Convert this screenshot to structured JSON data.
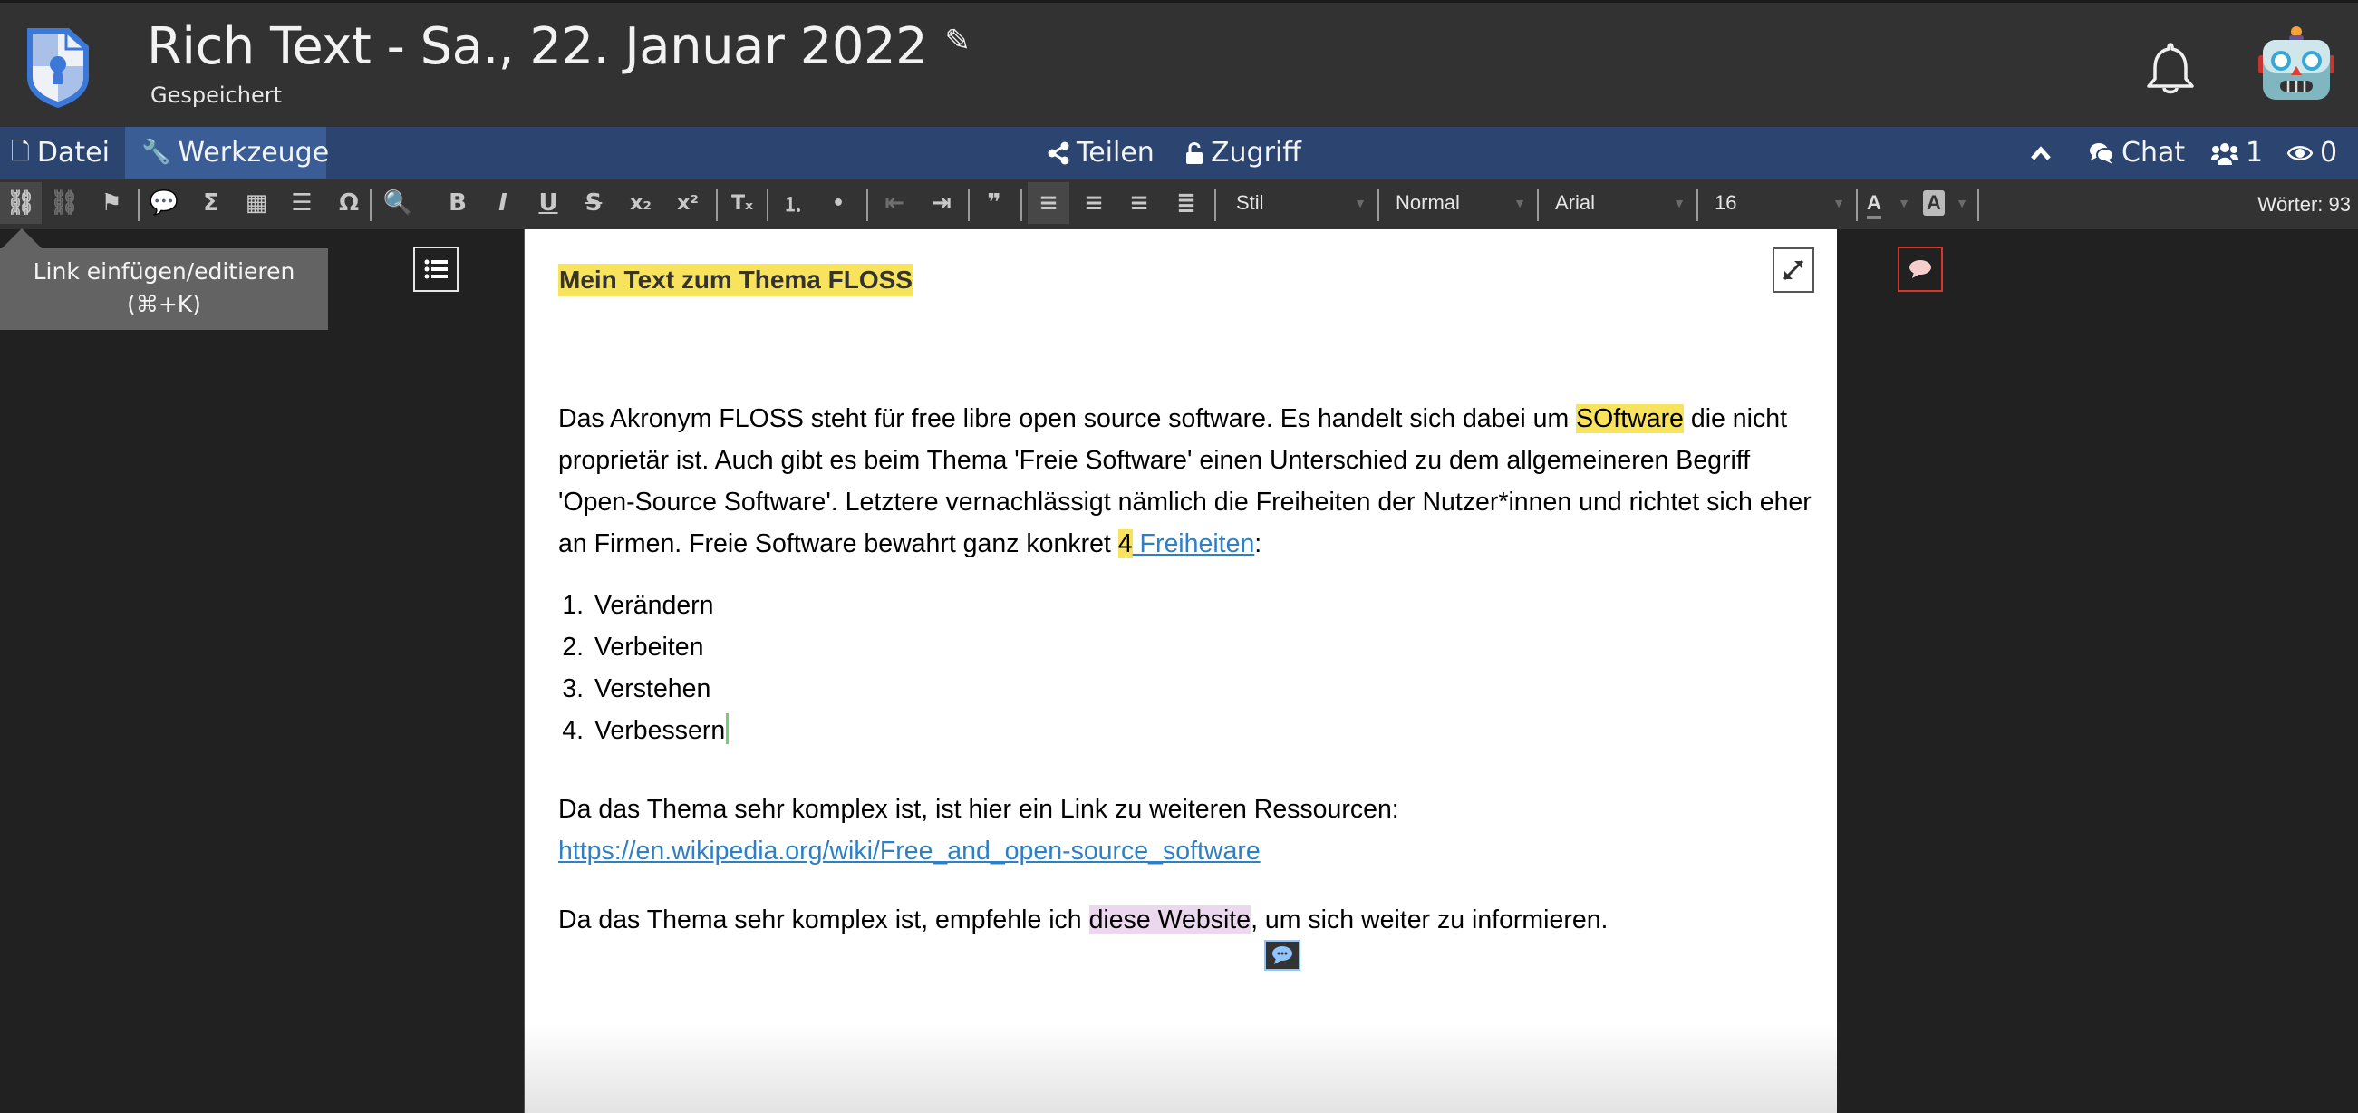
{
  "header": {
    "title": "Rich Text - Sa., 22. Januar 2022",
    "status": "Gespeichert",
    "edit_icon": "pencil-icon",
    "notifications_icon": "bell-icon",
    "avatar_icon": "robot-face-icon",
    "logo_icon": "shield-keyhole-logo"
  },
  "menubar": {
    "file": {
      "label": "Datei",
      "icon": "file-icon"
    },
    "tools": {
      "label": "Werkzeuge",
      "icon": "wrench-icon"
    },
    "share": {
      "label": "Teilen",
      "icon": "share-icon"
    },
    "access": {
      "label": "Zugriff",
      "icon": "unlock-icon"
    },
    "collapse_icon": "chevron-up-icon",
    "chat": {
      "label": "Chat",
      "icon": "comments-icon"
    },
    "users": {
      "count": "1",
      "icon": "users-icon"
    },
    "viewers": {
      "count": "0",
      "icon": "eye-icon"
    }
  },
  "toolbar": {
    "buttons": [
      {
        "name": "link",
        "glyph": "⛓",
        "state": "active"
      },
      {
        "name": "unlink",
        "glyph": "⛓",
        "state": "disabled"
      },
      {
        "name": "anchor",
        "glyph": "⚑",
        "state": "normal"
      },
      {
        "name": "comment",
        "glyph": "💬",
        "state": "normal"
      },
      {
        "name": "math",
        "glyph": "Σ",
        "state": "normal"
      },
      {
        "name": "table",
        "glyph": "▦",
        "state": "normal"
      },
      {
        "name": "horizontal-line",
        "glyph": "☰",
        "state": "normal"
      },
      {
        "name": "special-char",
        "glyph": "Ω",
        "state": "normal"
      },
      {
        "name": "preview",
        "glyph": "🔍",
        "state": "normal"
      },
      {
        "name": "bold",
        "glyph": "B",
        "state": "normal"
      },
      {
        "name": "italic",
        "glyph": "I",
        "state": "normal"
      },
      {
        "name": "underline",
        "glyph": "U",
        "state": "normal"
      },
      {
        "name": "strike",
        "glyph": "S",
        "state": "normal"
      },
      {
        "name": "subscript",
        "glyph": "x₂",
        "state": "normal"
      },
      {
        "name": "superscript",
        "glyph": "x²",
        "state": "normal"
      },
      {
        "name": "remove-format",
        "glyph": "Tₓ",
        "state": "normal"
      },
      {
        "name": "numbered-list",
        "glyph": "⒈",
        "state": "normal"
      },
      {
        "name": "bulleted-list",
        "glyph": "•",
        "state": "normal"
      },
      {
        "name": "outdent",
        "glyph": "⇤",
        "state": "disabled"
      },
      {
        "name": "indent",
        "glyph": "⇥",
        "state": "normal"
      },
      {
        "name": "blockquote",
        "glyph": "❞",
        "state": "normal"
      },
      {
        "name": "align-left",
        "glyph": "≡",
        "state": "active"
      },
      {
        "name": "align-center",
        "glyph": "≡",
        "state": "normal"
      },
      {
        "name": "align-right",
        "glyph": "≡",
        "state": "normal"
      },
      {
        "name": "justify",
        "glyph": "≣",
        "state": "normal"
      }
    ],
    "style": "Stil",
    "format": "Normal",
    "font": "Arial",
    "size": "16",
    "text_color_glyph": "A",
    "bg_color_glyph": "A",
    "word_count": "Wörter: 93"
  },
  "tooltip": {
    "line1": "Link einfügen/editieren",
    "line2": "(⌘+K)"
  },
  "document": {
    "heading": "Mein Text zum Thema FLOSS",
    "p1": {
      "before": "Das Akronym FLOSS steht für free libre open source software. Es handelt sich dabei um ",
      "highlight": "SOftware",
      "after": " die nicht proprietär ist. Auch gibt es beim Thema 'Freie Software' einen Unterschied zu dem allgemeineren Begriff 'Open-Source Software'. Letztere vernachlässigt nämlich die Freiheiten der Nutzer*innen und richtet sich eher an Firmen. Freie Software bewahrt ganz konkret ",
      "num": "4",
      "link": " Freiheiten",
      "end": ":"
    },
    "list": [
      "Verändern",
      "Verbeiten",
      "Verstehen",
      "Verbessern"
    ],
    "p2": {
      "before": "Da das Thema sehr komplex ist, ist hier ein Link zu weiteren Ressourcen: ",
      "link": "https://en.wikipedia.org/wiki/Free_and_open-source_software"
    },
    "p3": {
      "before": "Da das Thema sehr komplex ist, empfehle ich ",
      "highlight": "diese Website",
      "after": ", um sich weiter zu informieren."
    }
  },
  "colors": {
    "header_bg": "#323232",
    "menubar_bg": "#2b4470",
    "menubar_active": "#3a5d96",
    "toolbar_bg": "#333333",
    "highlight_yellow": "#f8e45c",
    "highlight_pink": "#ecd8ee",
    "link": "#2f7fc4"
  }
}
